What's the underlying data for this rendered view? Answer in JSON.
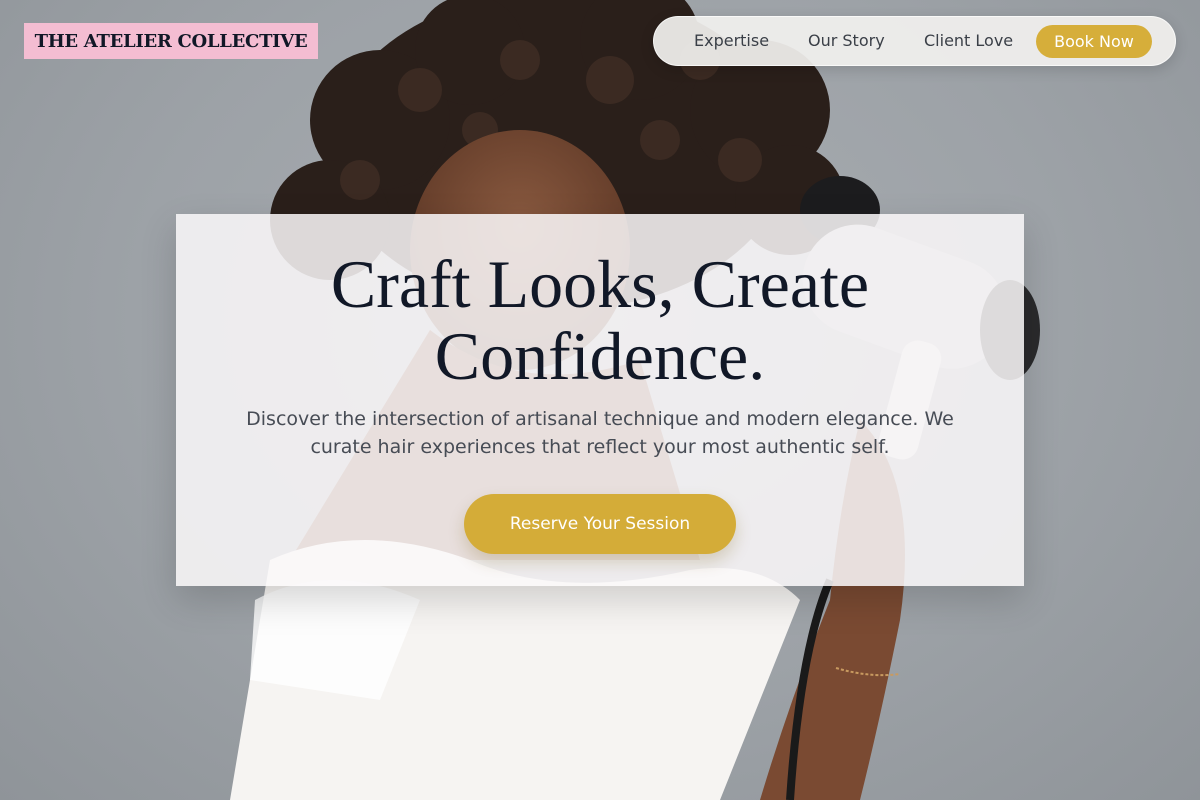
{
  "brand": {
    "name": "THE ATELIER COLLECTIVE"
  },
  "nav": {
    "links": [
      {
        "label": "Expertise"
      },
      {
        "label": "Our Story"
      },
      {
        "label": "Client Love"
      }
    ],
    "book_label": "Book Now"
  },
  "hero": {
    "headline_line1": "Craft Looks, Create",
    "headline_line2": "Confidence.",
    "subtext_line1": "Discover the intersection of artisanal technique and modern elegance. We",
    "subtext_line2": "curate hair experiences that reflect your most authentic self.",
    "cta_label": "Reserve Your Session",
    "background_image": "woman-with-curly-hair-drying-hair-photo"
  },
  "colors": {
    "logo_bg": "#f4bdd2",
    "accent_gold": "#d4ac38",
    "text_dark": "#111827",
    "text_muted": "#474c55",
    "backdrop_gray": "#9ea3a8"
  }
}
